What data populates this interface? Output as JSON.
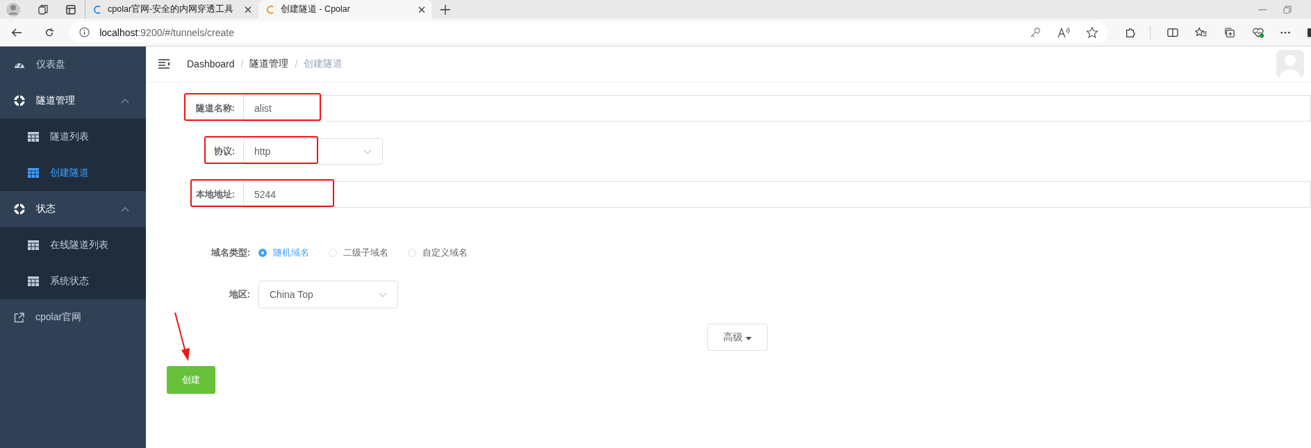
{
  "browser": {
    "tabs": [
      {
        "title": "cpolar官网-安全的内网穿透工具",
        "selected": false
      },
      {
        "title": "创建隧道 - Cpolar",
        "selected": true
      }
    ],
    "address": {
      "host": "localhost",
      "rest": ":9200/#/tunnels/create"
    }
  },
  "sidebar": {
    "items": [
      {
        "label": "仪表盘",
        "selected": false
      },
      {
        "label": "隧道管理",
        "expanded": true,
        "selected": false,
        "children": [
          {
            "label": "隧道列表",
            "selected": false
          },
          {
            "label": "创建隧道",
            "selected": true
          }
        ]
      },
      {
        "label": "状态",
        "expanded": true,
        "selected": false,
        "children": [
          {
            "label": "在线隧道列表",
            "selected": false
          },
          {
            "label": "系统状态",
            "selected": false
          }
        ]
      },
      {
        "label": "cpolar官网",
        "selected": false
      }
    ]
  },
  "breadcrumb": {
    "separator": "/",
    "items": [
      {
        "label": "Dashboard",
        "current": false
      },
      {
        "label": "隧道管理",
        "current": false
      },
      {
        "label": "创建隧道",
        "current": true
      }
    ]
  },
  "form": {
    "fields": [
      {
        "kind": "input",
        "label": "隧道名称:",
        "value": "alist",
        "highlighted": true
      },
      {
        "kind": "select",
        "label": "协议:",
        "value": "http",
        "highlighted": true
      },
      {
        "kind": "input",
        "label": "本地地址:",
        "value": "5244",
        "highlighted": true
      }
    ],
    "domain_type": {
      "label": "域名类型:",
      "options": [
        {
          "label": "随机域名",
          "selected": true
        },
        {
          "label": "二级子域名",
          "selected": false
        },
        {
          "label": "自定义域名",
          "selected": false
        }
      ]
    },
    "region": {
      "label": "地区:",
      "value": "China Top"
    },
    "advanced_button": "高级",
    "submit_button": "创建"
  }
}
